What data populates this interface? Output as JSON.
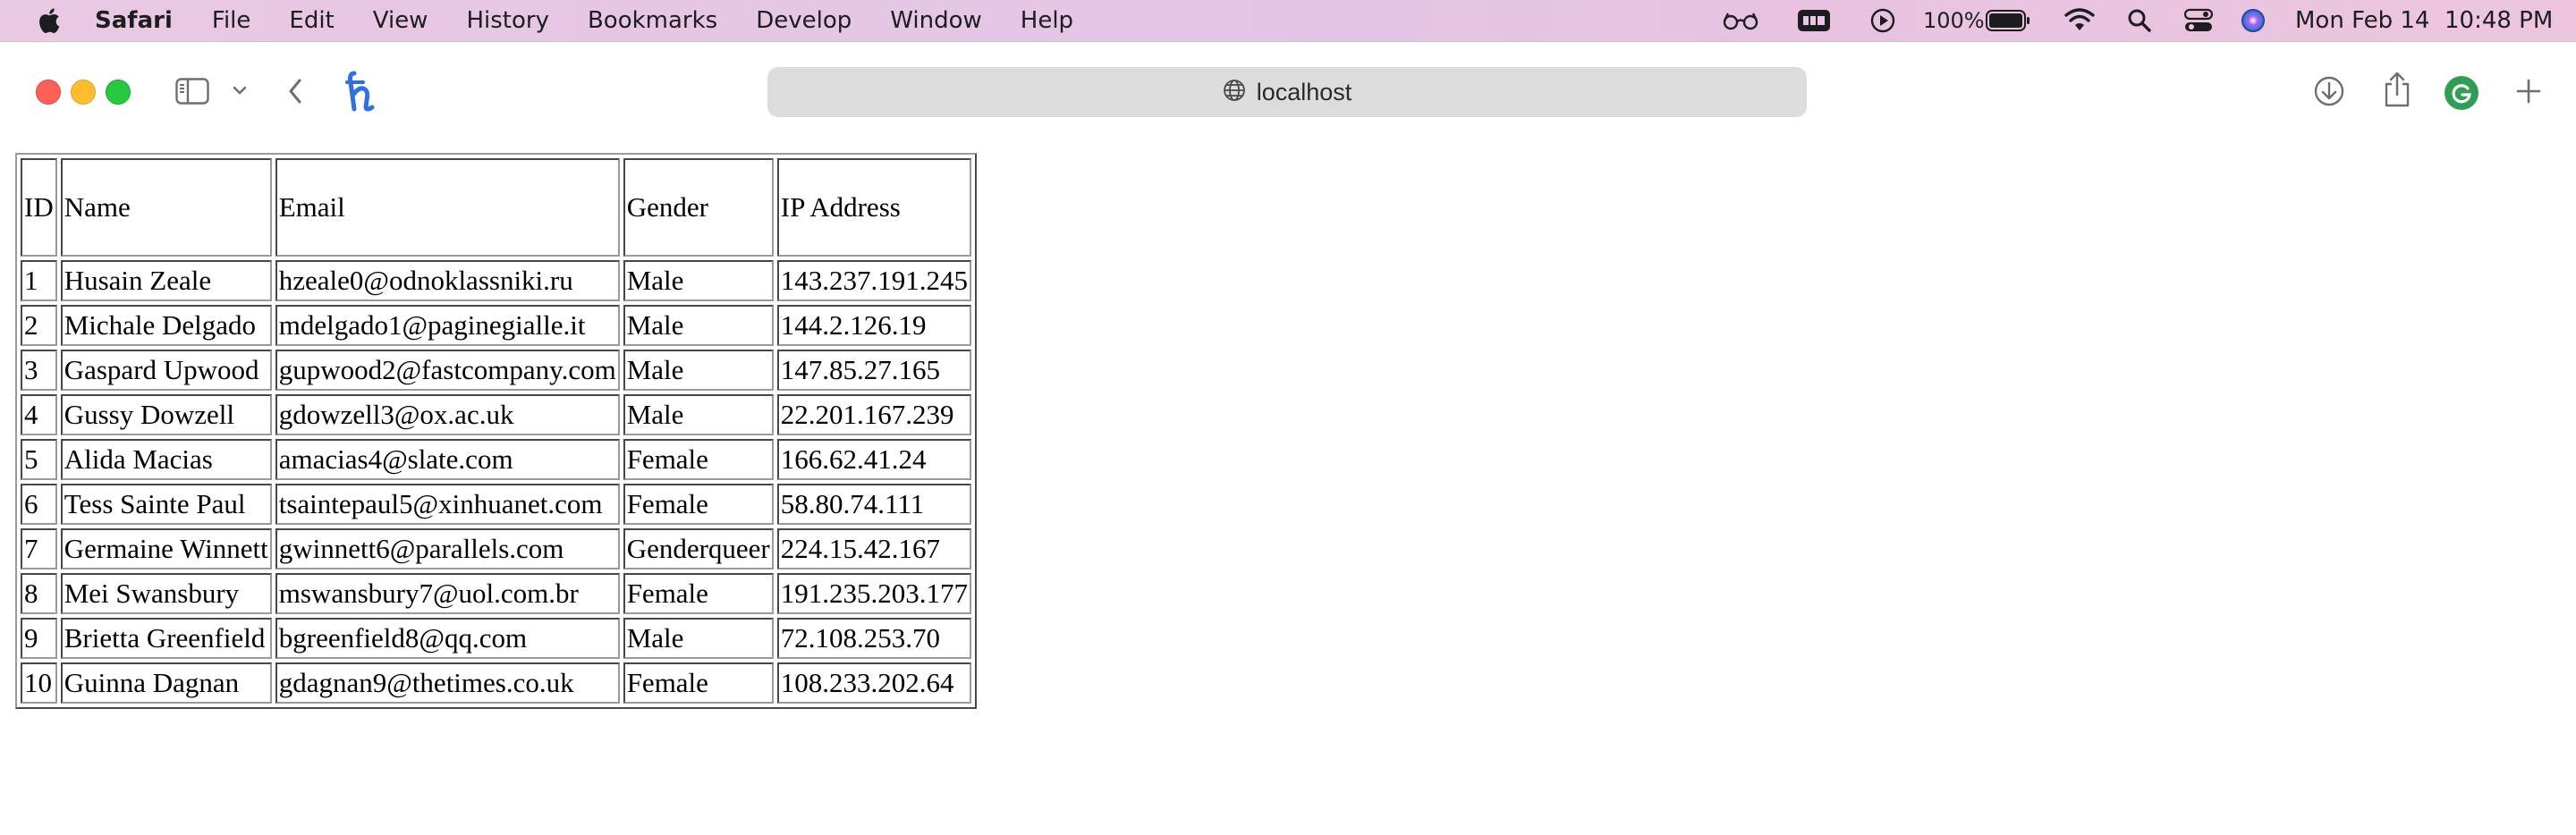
{
  "menubar": {
    "app_name": "Safari",
    "items": [
      "File",
      "Edit",
      "View",
      "History",
      "Bookmarks",
      "Develop",
      "Window",
      "Help"
    ],
    "battery_percent": "100%",
    "battery_level": 1.0,
    "datetime": "Mon Feb 14  10:48 PM"
  },
  "toolbar": {
    "address": "localhost",
    "extension_icon": "honey-h-icon",
    "accent": "#2f6fe3"
  },
  "colors": {
    "close": "#fe5f57",
    "minimize": "#febc2e",
    "zoom": "#28c840",
    "avatar": "#2f9e54"
  },
  "table": {
    "headers": [
      "ID",
      "Name",
      "Email",
      "Gender",
      "IP Address"
    ],
    "rows": [
      [
        "1",
        "Husain Zeale",
        "hzeale0@odnoklassniki.ru",
        "Male",
        "143.237.191.245"
      ],
      [
        "2",
        "Michale Delgado",
        "mdelgado1@paginegialle.it",
        "Male",
        "144.2.126.19"
      ],
      [
        "3",
        "Gaspard Upwood",
        "gupwood2@fastcompany.com",
        "Male",
        "147.85.27.165"
      ],
      [
        "4",
        "Gussy Dowzell",
        "gdowzell3@ox.ac.uk",
        "Male",
        "22.201.167.239"
      ],
      [
        "5",
        "Alida Macias",
        "amacias4@slate.com",
        "Female",
        "166.62.41.24"
      ],
      [
        "6",
        "Tess Sainte Paul",
        "tsaintepaul5@xinhuanet.com",
        "Female",
        "58.80.74.111"
      ],
      [
        "7",
        "Germaine Winnett",
        "gwinnett6@parallels.com",
        "Genderqueer",
        "224.15.42.167"
      ],
      [
        "8",
        "Mei Swansbury",
        "mswansbury7@uol.com.br",
        "Female",
        "191.235.203.177"
      ],
      [
        "9",
        "Brietta Greenfield",
        "bgreenfield8@qq.com",
        "Male",
        "72.108.253.70"
      ],
      [
        "10",
        "Guinna Dagnan",
        "gdagnan9@thetimes.co.uk",
        "Female",
        "108.233.202.64"
      ]
    ]
  }
}
